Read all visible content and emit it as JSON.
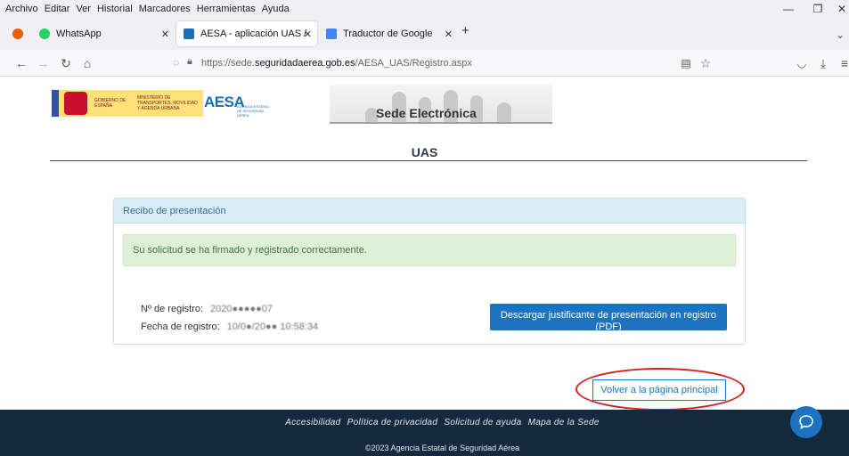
{
  "menu": [
    "Archivo",
    "Editar",
    "Ver",
    "Historial",
    "Marcadores",
    "Herramientas",
    "Ayuda"
  ],
  "tabs": [
    {
      "label": "WhatsApp",
      "icon": "whatsapp-icon",
      "color": "#25d366"
    },
    {
      "label": "AESA - aplicación UAS / UAS w…",
      "icon": "aesa-icon",
      "color": "#1b6fb5"
    },
    {
      "label": "Traductor de Google",
      "icon": "translate-icon",
      "color": "#4285f4"
    }
  ],
  "url": {
    "prefix": "https://sede.",
    "domain": "seguridadaerea.gob.es",
    "path": "/AESA_UAS/Registro.aspx"
  },
  "header": {
    "gobierno": "GOBIERNO DE ESPAÑA",
    "ministerio": "MINISTERIO DE TRANSPORTES, MOVILIDAD Y AGENDA URBANA",
    "aesa": "AESA",
    "aesa_sub": "AGENCIA ESTATAL DE SEGURIDAD AÉREA",
    "sede": "Sede Electrónica"
  },
  "page_title": "UAS",
  "panel": {
    "heading": "Recibo de presentación",
    "success_message": "Su solicitud se ha firmado y registrado correctamente.",
    "registro_label": "Nº de registro:",
    "registro_value": "2020●●●●●07",
    "fecha_label": "Fecha de registro:",
    "fecha_value": "10/0●/20●● 10:58:34",
    "download_label": "Descargar justificante de presentación en registro (PDF)"
  },
  "back_label": "Volver a la página principal",
  "footer": {
    "links": [
      "Accesibilidad",
      "Política de privacidad",
      "Solicitud de ayuda",
      "Mapa de la Sede"
    ],
    "copyright": "©2023 Agencia Estatal de Seguridad Aérea"
  },
  "colors": {
    "primary": "#1e73be",
    "footer_bg": "#13293d",
    "annotation": "#d81c1c"
  }
}
